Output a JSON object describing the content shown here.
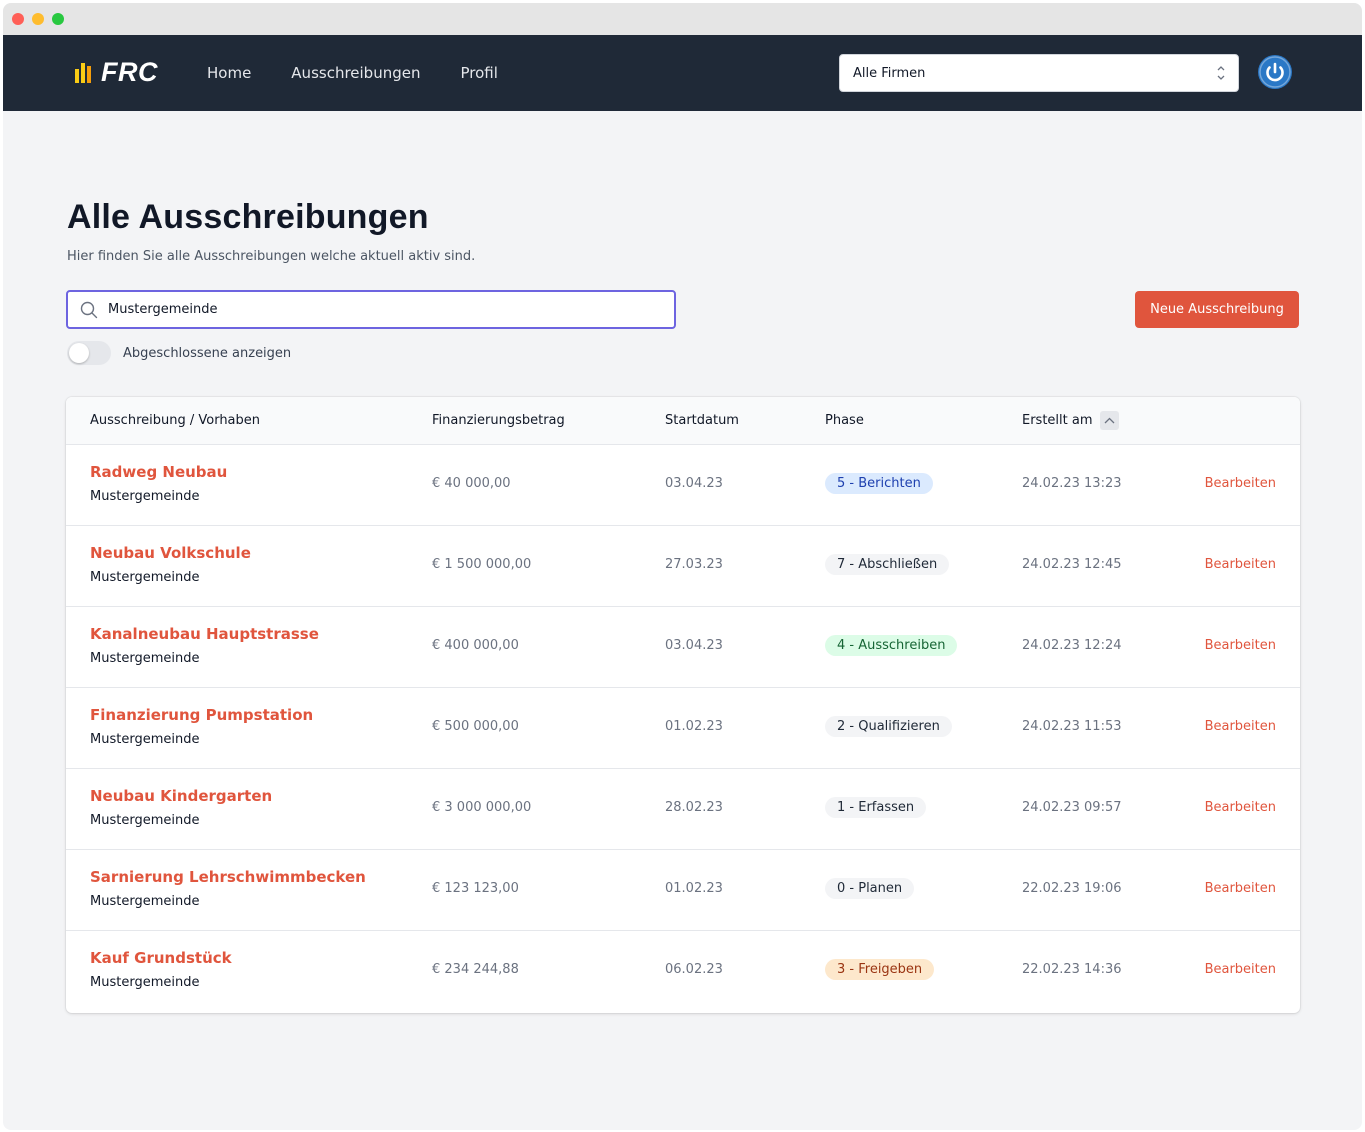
{
  "nav": {
    "logo": "FRC",
    "links": [
      "Home",
      "Ausschreibungen",
      "Profil"
    ],
    "company_select": "Alle Firmen"
  },
  "page": {
    "title": "Alle Ausschreibungen",
    "subtitle": "Hier finden Sie alle Ausschreibungen welche aktuell aktiv sind.",
    "search_value": "Mustergemeinde",
    "new_button": "Neue Ausschreibung",
    "toggle_label": "Abgeschlossene anzeigen",
    "toggle_on": false
  },
  "table": {
    "headers": [
      "Ausschreibung / Vorhaben",
      "Finanzierungsbetrag",
      "Startdatum",
      "Phase",
      "Erstellt am"
    ],
    "rows": [
      {
        "name": "Radweg Neubau",
        "org": "Mustergemeinde",
        "amount": "€ 40 000,00",
        "start": "03.04.23",
        "phase": "5 - Berichten",
        "phase_color": "blue",
        "created": "24.02.23 13:23",
        "action": "Bearbeiten"
      },
      {
        "name": "Neubau Volkschule",
        "org": "Mustergemeinde",
        "amount": "€ 1 500 000,00",
        "start": "27.03.23",
        "phase": "7 - Abschließen",
        "phase_color": "gray",
        "created": "24.02.23 12:45",
        "action": "Bearbeiten"
      },
      {
        "name": "Kanalneubau Hauptstrasse",
        "org": "Mustergemeinde",
        "amount": "€ 400 000,00",
        "start": "03.04.23",
        "phase": "4 - Ausschreiben",
        "phase_color": "green",
        "created": "24.02.23 12:24",
        "action": "Bearbeiten"
      },
      {
        "name": "Finanzierung Pumpstation",
        "org": "Mustergemeinde",
        "amount": "€ 500 000,00",
        "start": "01.02.23",
        "phase": "2 - Qualifizieren",
        "phase_color": "gray",
        "created": "24.02.23 11:53",
        "action": "Bearbeiten"
      },
      {
        "name": "Neubau Kindergarten",
        "org": "Mustergemeinde",
        "amount": "€ 3 000 000,00",
        "start": "28.02.23",
        "phase": "1 - Erfassen",
        "phase_color": "gray",
        "created": "24.02.23 09:57",
        "action": "Bearbeiten"
      },
      {
        "name": "Sarnierung Lehrschwimmbecken",
        "org": "Mustergemeinde",
        "amount": "€ 123 123,00",
        "start": "01.02.23",
        "phase": "0 - Planen",
        "phase_color": "gray",
        "created": "22.02.23 19:06",
        "action": "Bearbeiten"
      },
      {
        "name": "Kauf Grundstück",
        "org": "Mustergemeinde",
        "amount": "€ 234 244,88",
        "start": "06.02.23",
        "phase": "3 - Freigeben",
        "phase_color": "orange",
        "created": "22.02.23 14:36",
        "action": "Bearbeiten"
      }
    ]
  },
  "colors": {
    "navbar": "#1f2937",
    "accent": "#e0553d",
    "focus": "#6d64e0",
    "badge_blue_bg": "#dbeafe",
    "badge_blue_fg": "#1e40af",
    "badge_green_bg": "#dcfce7",
    "badge_green_fg": "#166534",
    "badge_gray_bg": "#f3f4f6",
    "badge_gray_fg": "#1f2937",
    "badge_orange_bg": "#fde8cc",
    "badge_orange_fg": "#9a3412"
  }
}
